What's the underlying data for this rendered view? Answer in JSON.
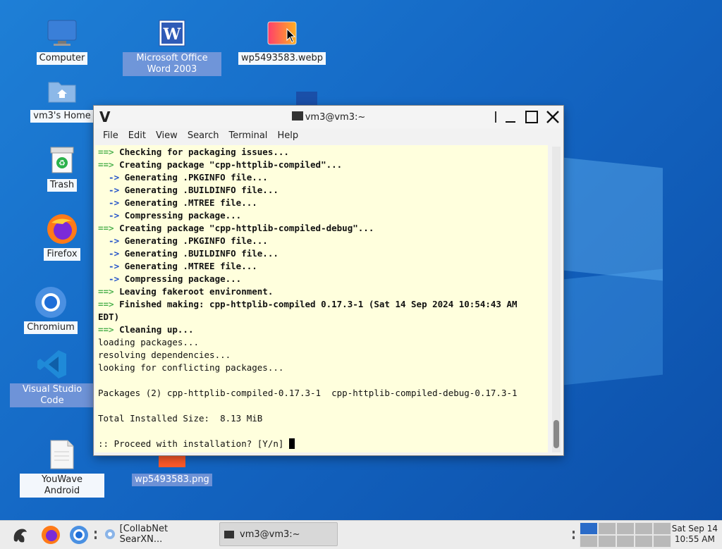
{
  "desktop": {
    "icons": [
      {
        "label": "Computer"
      },
      {
        "label": "Microsoft Office Word 2003"
      },
      {
        "label": "wp5493583.webp"
      },
      {
        "label": "vm3's Home"
      },
      {
        "label": "Trash"
      },
      {
        "label": "Firefox"
      },
      {
        "label": "Chromium"
      },
      {
        "label": "Visual Studio Code"
      },
      {
        "label": "YouWave Android"
      },
      {
        "label": "wp5493583.png"
      }
    ]
  },
  "window": {
    "title": "vm3@vm3:~",
    "menu": [
      "File",
      "Edit",
      "View",
      "Search",
      "Terminal",
      "Help"
    ]
  },
  "terminal": {
    "lines": [
      {
        "p": "==> ",
        "t": "Checking for packaging issues...",
        "kind": "ar"
      },
      {
        "p": "==> ",
        "t": "Creating package \"cpp-httplib-compiled\"...",
        "kind": "ar"
      },
      {
        "p": "  -> ",
        "t": "Generating .PKGINFO file...",
        "kind": "bl"
      },
      {
        "p": "  -> ",
        "t": "Generating .BUILDINFO file...",
        "kind": "bl"
      },
      {
        "p": "  -> ",
        "t": "Generating .MTREE file...",
        "kind": "bl"
      },
      {
        "p": "  -> ",
        "t": "Compressing package...",
        "kind": "bl"
      },
      {
        "p": "==> ",
        "t": "Creating package \"cpp-httplib-compiled-debug\"...",
        "kind": "ar"
      },
      {
        "p": "  -> ",
        "t": "Generating .PKGINFO file...",
        "kind": "bl"
      },
      {
        "p": "  -> ",
        "t": "Generating .BUILDINFO file...",
        "kind": "bl"
      },
      {
        "p": "  -> ",
        "t": "Generating .MTREE file...",
        "kind": "bl"
      },
      {
        "p": "  -> ",
        "t": "Compressing package...",
        "kind": "bl"
      },
      {
        "p": "==> ",
        "t": "Leaving fakeroot environment.",
        "kind": "ar"
      },
      {
        "p": "==> ",
        "t": "Finished making: cpp-httplib-compiled 0.17.3-1 (Sat 14 Sep 2024 10:54:43 AM",
        "kind": "ar"
      },
      {
        "p": "",
        "t": "EDT)",
        "kind": "bold"
      },
      {
        "p": "==> ",
        "t": "Cleaning up...",
        "kind": "ar"
      },
      {
        "p": "",
        "t": "loading packages...",
        "kind": "plain"
      },
      {
        "p": "",
        "t": "resolving dependencies...",
        "kind": "plain"
      },
      {
        "p": "",
        "t": "looking for conflicting packages...",
        "kind": "plain"
      },
      {
        "p": "",
        "t": "",
        "kind": "plain"
      },
      {
        "p": "",
        "t": "Packages (2) cpp-httplib-compiled-0.17.3-1  cpp-httplib-compiled-debug-0.17.3-1",
        "kind": "plain"
      },
      {
        "p": "",
        "t": "",
        "kind": "plain"
      },
      {
        "p": "",
        "t": "Total Installed Size:  8.13 MiB",
        "kind": "plain"
      },
      {
        "p": "",
        "t": "",
        "kind": "plain"
      },
      {
        "p": "",
        "t": ":: Proceed with installation? [Y/n] ",
        "kind": "prompt"
      }
    ]
  },
  "taskbar": {
    "tasks": [
      {
        "label": "[CollabNet SearXN..."
      },
      {
        "label": "vm3@vm3:~"
      }
    ],
    "clock": {
      "date": "Sat Sep 14",
      "time": "10:55 AM"
    }
  },
  "colors": {
    "accent": "#2a6bc8",
    "terminal_bg": "#ffffdd",
    "arrow_green": "#4fb24f",
    "arrow_blue": "#2050c8"
  }
}
